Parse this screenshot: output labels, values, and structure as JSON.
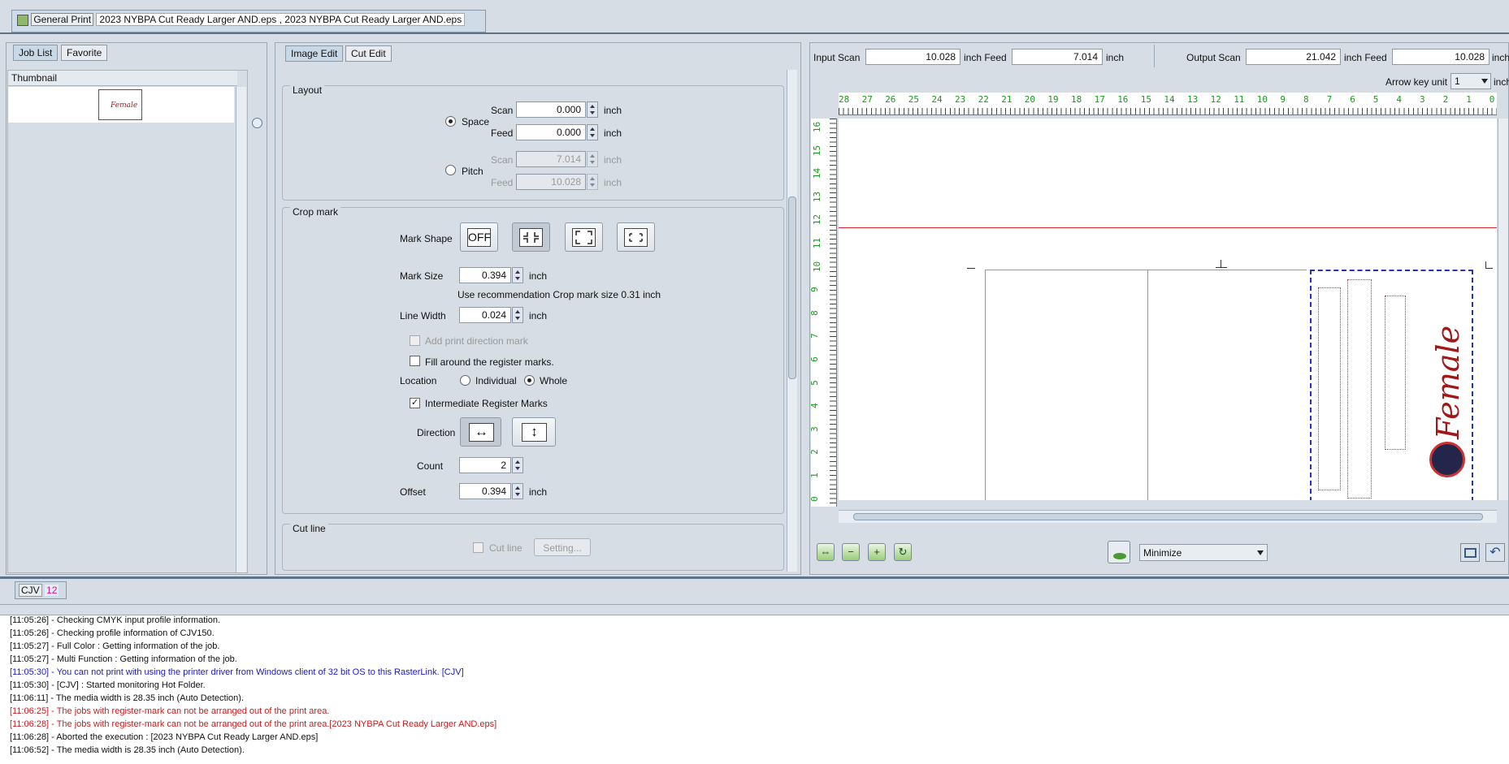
{
  "top_tab": {
    "label": "General Print",
    "file": "2023 NYBPA Cut Ready Larger AND.eps , 2023 NYBPA Cut Ready Larger AND.eps"
  },
  "left": {
    "tabs": [
      "Job List",
      "Favorite"
    ],
    "thumb_header": "Thumbnail",
    "thumb_text": "Female"
  },
  "edit_tabs": [
    "Image Edit",
    "Cut Edit"
  ],
  "layout": {
    "title": "Layout",
    "space_label": "Space",
    "pitch_label": "Pitch",
    "scan_label": "Scan",
    "feed_label": "Feed",
    "space_scan": "0.000",
    "space_feed": "0.000",
    "pitch_scan": "7.014",
    "pitch_feed": "10.028",
    "unit": "inch"
  },
  "crop": {
    "title": "Crop mark",
    "mark_shape_label": "Mark Shape",
    "off_label": "OFF",
    "mark_size_label": "Mark Size",
    "mark_size": "0.394",
    "recommendation": "Use recommendation Crop mark size 0.31 inch",
    "line_width_label": "Line Width",
    "line_width": "0.024",
    "add_direction": "Add print direction mark",
    "fill_around": "Fill around the register marks.",
    "location_label": "Location",
    "individual": "Individual",
    "whole": "Whole",
    "intermediate": "Intermediate Register Marks",
    "direction_label": "Direction",
    "count_label": "Count",
    "count": "2",
    "offset_label": "Offset",
    "offset": "0.394",
    "unit": "inch"
  },
  "cutline": {
    "title": "Cut line",
    "cut_line": "Cut line",
    "setting": "Setting..."
  },
  "preview": {
    "input_scan_label": "Input Scan",
    "input_scan": "10.028",
    "input_feed": "7.014",
    "output_scan_label": "Output Scan",
    "output_scan": "21.042",
    "output_feed": "10.028",
    "inch_feed": "inch Feed",
    "inch": "inch",
    "arrow_label": "Arrow key unit",
    "arrow_value": "1",
    "arrow_unit": "inch",
    "top_ruler": [
      "28",
      "27",
      "26",
      "25",
      "24",
      "23",
      "22",
      "21",
      "20",
      "19",
      "18",
      "17",
      "16",
      "15",
      "14",
      "13",
      "12",
      "11",
      "10",
      "9",
      "8",
      "7",
      "6",
      "5",
      "4",
      "3",
      "2",
      "1",
      "0"
    ],
    "side_ruler": [
      "16",
      "15",
      "14",
      "13",
      "12",
      "11",
      "10",
      "9",
      "8",
      "7",
      "6",
      "5",
      "4",
      "3",
      "2",
      "1",
      "0"
    ],
    "minimize": "Minimize"
  },
  "printer_tab": {
    "name": "CJV",
    "count": "12"
  },
  "log": [
    {
      "t": "[11:05:26] - Checking CMYK input profile information.",
      "c": "#111"
    },
    {
      "t": "[11:05:26] - Checking profile information of CJV150.",
      "c": "#111"
    },
    {
      "t": "[11:05:27] - Full Color : Getting information of the job.",
      "c": "#111"
    },
    {
      "t": "[11:05:27] - Multi Function : Getting information of the job.",
      "c": "#111"
    },
    {
      "t": "[11:05:30] - You can not print with using the printer driver from Windows client of 32 bit OS to this RasterLink. [CJV]",
      "c": "#1a1acc"
    },
    {
      "t": "[11:05:30] - [CJV] : Started monitoring Hot Folder.",
      "c": "#111"
    },
    {
      "t": "[11:06:11] - The media width is 28.35 inch (Auto Detection).",
      "c": "#111"
    },
    {
      "t": "[11:06:25] - The jobs with register-mark can not be arranged out of the print area.",
      "c": "#cc1a1a"
    },
    {
      "t": "[11:06:28] - The jobs with register-mark can not be arranged out of the print area.[2023 NYBPA Cut Ready Larger AND.eps]",
      "c": "#cc1a1a"
    },
    {
      "t": "[11:06:28] - Aborted the execution : [2023 NYBPA Cut Ready Larger AND.eps]",
      "c": "#111"
    },
    {
      "t": "[11:06:52] - The media width is 28.35 inch (Auto Detection).",
      "c": "#111"
    }
  ]
}
